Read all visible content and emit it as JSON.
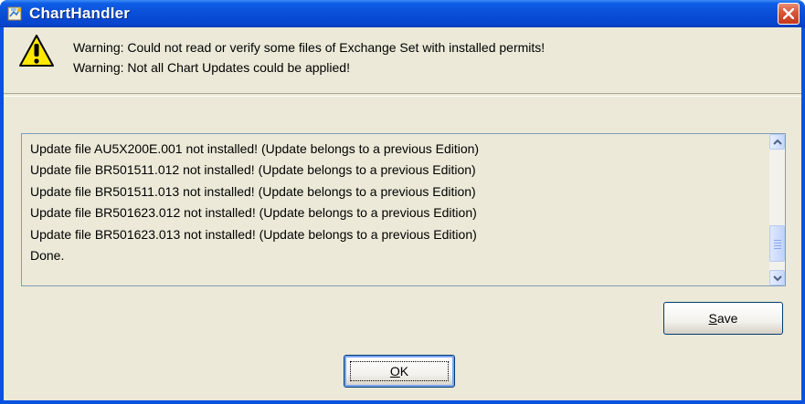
{
  "window": {
    "title": "ChartHandler"
  },
  "warnings": [
    "Warning: Could not read or verify some files of Exchange Set with installed permits!",
    "Warning: Not all Chart Updates could be applied!"
  ],
  "log": {
    "lines": [
      "Update file AU5X200E.001 not installed! (Update belongs to a previous Edition)",
      "Update file BR501511.012 not installed! (Update belongs to a previous Edition)",
      "Update file BR501511.013 not installed! (Update belongs to a previous Edition)",
      "Update file BR501623.012 not installed! (Update belongs to a previous Edition)",
      "Update file BR501623.013 not installed! (Update belongs to a previous Edition)",
      "Done."
    ]
  },
  "buttons": {
    "save_mnemonic": "S",
    "save_rest": "ave",
    "ok_mnemonic": "O",
    "ok_rest": "K"
  },
  "colors": {
    "titlebar": "#0a4ed8",
    "client_bg": "#ece9d8",
    "close_red": "#d9593a",
    "warning_yellow": "#ffe800"
  },
  "icons": {
    "app": "app-icon",
    "warning": "warning-icon",
    "close": "close-icon"
  }
}
